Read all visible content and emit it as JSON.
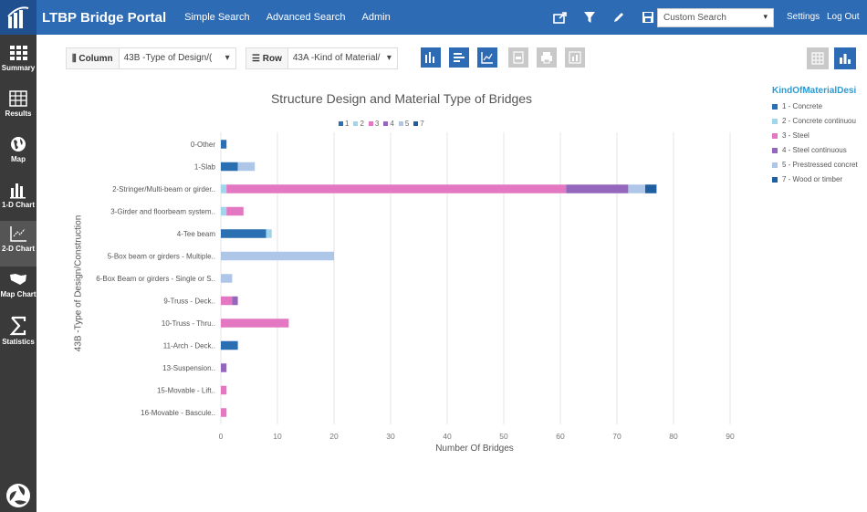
{
  "app": {
    "title": "LTBP Bridge Portal",
    "nav": [
      "Simple Search",
      "Advanced Search",
      "Admin"
    ],
    "custom_search_value": "Custom Search",
    "settings_label": "Settings",
    "logout_label": "Log Out",
    "header_color": "#2e6bb5"
  },
  "sidebar": {
    "items": [
      {
        "label": "Summary",
        "icon": "grid-icon"
      },
      {
        "label": "Results",
        "icon": "table-icon"
      },
      {
        "label": "Map",
        "icon": "globe-icon"
      },
      {
        "label": "1-D Chart",
        "icon": "bar-chart-icon"
      },
      {
        "label": "2-D Chart",
        "icon": "scatter-chart-icon"
      },
      {
        "label": "Map Chart",
        "icon": "map-chart-icon"
      },
      {
        "label": "Statistics",
        "icon": "sigma-icon"
      }
    ],
    "active": "2-D Chart"
  },
  "toolbar": {
    "column_label": "Column",
    "column_value": "43B -Type of Design/(",
    "row_label": "Row",
    "row_value": "43A -Kind of Material/"
  },
  "chart_data": {
    "type": "bar",
    "orientation": "horizontal",
    "stacked": true,
    "title": "Structure Design and Material Type of Bridges",
    "xlabel": "Number Of Bridges",
    "ylabel": "43B -Type of Design/Construction",
    "xlim": [
      0,
      90
    ],
    "xticks": [
      0,
      10,
      20,
      30,
      40,
      50,
      60,
      70,
      80,
      90
    ],
    "grid": true,
    "categories": [
      "0-Other",
      "1-Slab",
      "2-Stringer/Multi-beam or girder..",
      "3-Girder and floorbeam system..",
      "4-Tee beam",
      "5-Box beam or girders - Multiple..",
      "6-Box Beam or girders - Single or S..",
      "9-Truss - Deck..",
      "10-Truss - Thru..",
      "11-Arch - Deck..",
      "13-Suspension..",
      "15-Movable - Lift..",
      "16-Movable - Bascule.."
    ],
    "series": [
      {
        "name": "1",
        "color": "#2a6fb1",
        "values": [
          1,
          3,
          0,
          0,
          8,
          0,
          0,
          0,
          0,
          3,
          0,
          0,
          0
        ]
      },
      {
        "name": "2",
        "color": "#9fd6ec",
        "values": [
          0,
          0,
          1,
          1,
          1,
          0,
          0,
          0,
          0,
          0,
          0,
          0,
          0
        ]
      },
      {
        "name": "3",
        "color": "#e377c2",
        "values": [
          0,
          0,
          60,
          3,
          0,
          0,
          0,
          2,
          12,
          0,
          0,
          1,
          1
        ]
      },
      {
        "name": "4",
        "color": "#9467bd",
        "values": [
          0,
          0,
          11,
          0,
          0,
          0,
          0,
          1,
          0,
          0,
          1,
          0,
          0
        ]
      },
      {
        "name": "5",
        "color": "#aec7e8",
        "values": [
          0,
          3,
          3,
          0,
          0,
          20,
          2,
          0,
          0,
          0,
          0,
          0,
          0
        ]
      },
      {
        "name": "7",
        "color": "#1f5fa0",
        "values": [
          0,
          0,
          2,
          0,
          0,
          0,
          0,
          0,
          0,
          0,
          0,
          0,
          0
        ]
      }
    ],
    "legend_title": "KindOfMaterialDesi",
    "legend_entries": [
      "1 - Concrete",
      "2 - Concrete continuou",
      "3 - Steel",
      "4 - Steel continuous",
      "5 - Prestressed concret",
      "7 - Wood or timber"
    ],
    "legend_placement": "right"
  }
}
